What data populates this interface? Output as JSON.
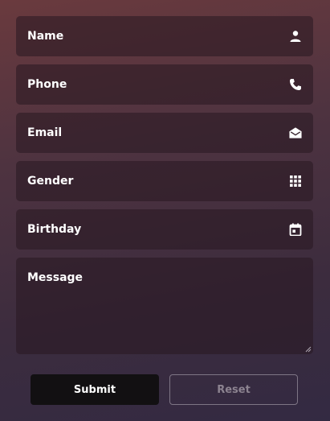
{
  "form": {
    "fields": [
      {
        "label": "Name",
        "icon": "person-icon"
      },
      {
        "label": "Phone",
        "icon": "phone-icon"
      },
      {
        "label": "Email",
        "icon": "envelope-open-icon"
      },
      {
        "label": "Gender",
        "icon": "grid-icon"
      },
      {
        "label": "Birthday",
        "icon": "calendar-icon"
      }
    ],
    "message_label": "Message"
  },
  "buttons": {
    "submit_label": "Submit",
    "reset_label": "Reset"
  },
  "colors": {
    "field_bg": "#2a1a22",
    "submit_bg": "#121012",
    "reset_border": "#7e7585",
    "text": "#ffffff"
  }
}
